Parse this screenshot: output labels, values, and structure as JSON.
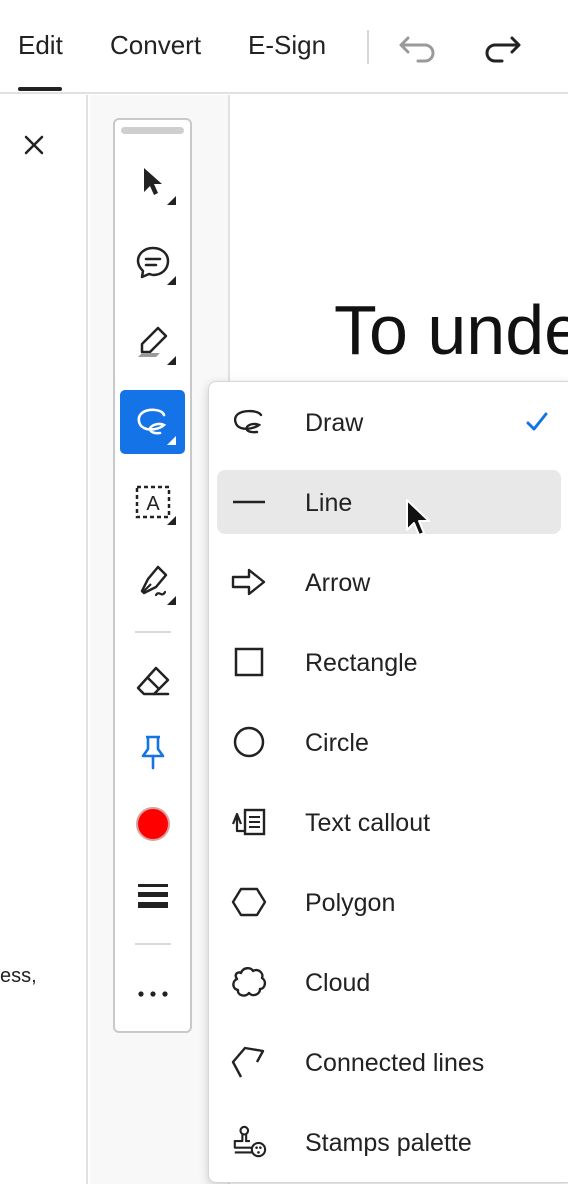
{
  "topbar": {
    "tabs": [
      {
        "label": "Edit",
        "active": true
      },
      {
        "label": "Convert",
        "active": false
      },
      {
        "label": "E-Sign",
        "active": false
      }
    ],
    "undo_icon": "undo-icon",
    "redo_icon": "redo-icon"
  },
  "left_panel": {
    "close_icon": "close-icon",
    "snippet": "ess,"
  },
  "document": {
    "heading_fragment": "To unde"
  },
  "toolbar": {
    "tools": [
      {
        "name": "select",
        "icon": "cursor-arrow-icon"
      },
      {
        "name": "comment",
        "icon": "comment-icon"
      },
      {
        "name": "highlight",
        "icon": "highlighter-icon"
      },
      {
        "name": "draw",
        "icon": "freehand-draw-icon",
        "active": true
      },
      {
        "name": "text",
        "icon": "text-box-icon"
      },
      {
        "name": "sign",
        "icon": "pen-nib-icon"
      },
      {
        "name": "eraser",
        "icon": "eraser-icon"
      },
      {
        "name": "pin",
        "icon": "pin-icon"
      },
      {
        "name": "color",
        "icon": "color-dot-icon",
        "color": "#ff0000"
      },
      {
        "name": "line-weight",
        "icon": "line-weight-icon"
      },
      {
        "name": "more",
        "icon": "more-icon"
      }
    ],
    "accent": "#1473e6"
  },
  "menu": {
    "items": [
      {
        "label": "Draw",
        "icon": "draw-icon",
        "checked": true
      },
      {
        "label": "Line",
        "icon": "line-icon",
        "hover": true
      },
      {
        "label": "Arrow",
        "icon": "arrow-icon"
      },
      {
        "label": "Rectangle",
        "icon": "rectangle-icon"
      },
      {
        "label": "Circle",
        "icon": "circle-icon"
      },
      {
        "label": "Text callout",
        "icon": "text-callout-icon"
      },
      {
        "label": "Polygon",
        "icon": "polygon-icon"
      },
      {
        "label": "Cloud",
        "icon": "cloud-icon"
      },
      {
        "label": "Connected lines",
        "icon": "connected-lines-icon"
      },
      {
        "label": "Stamps palette",
        "icon": "stamp-icon"
      }
    ],
    "check_color": "#1473e6"
  }
}
